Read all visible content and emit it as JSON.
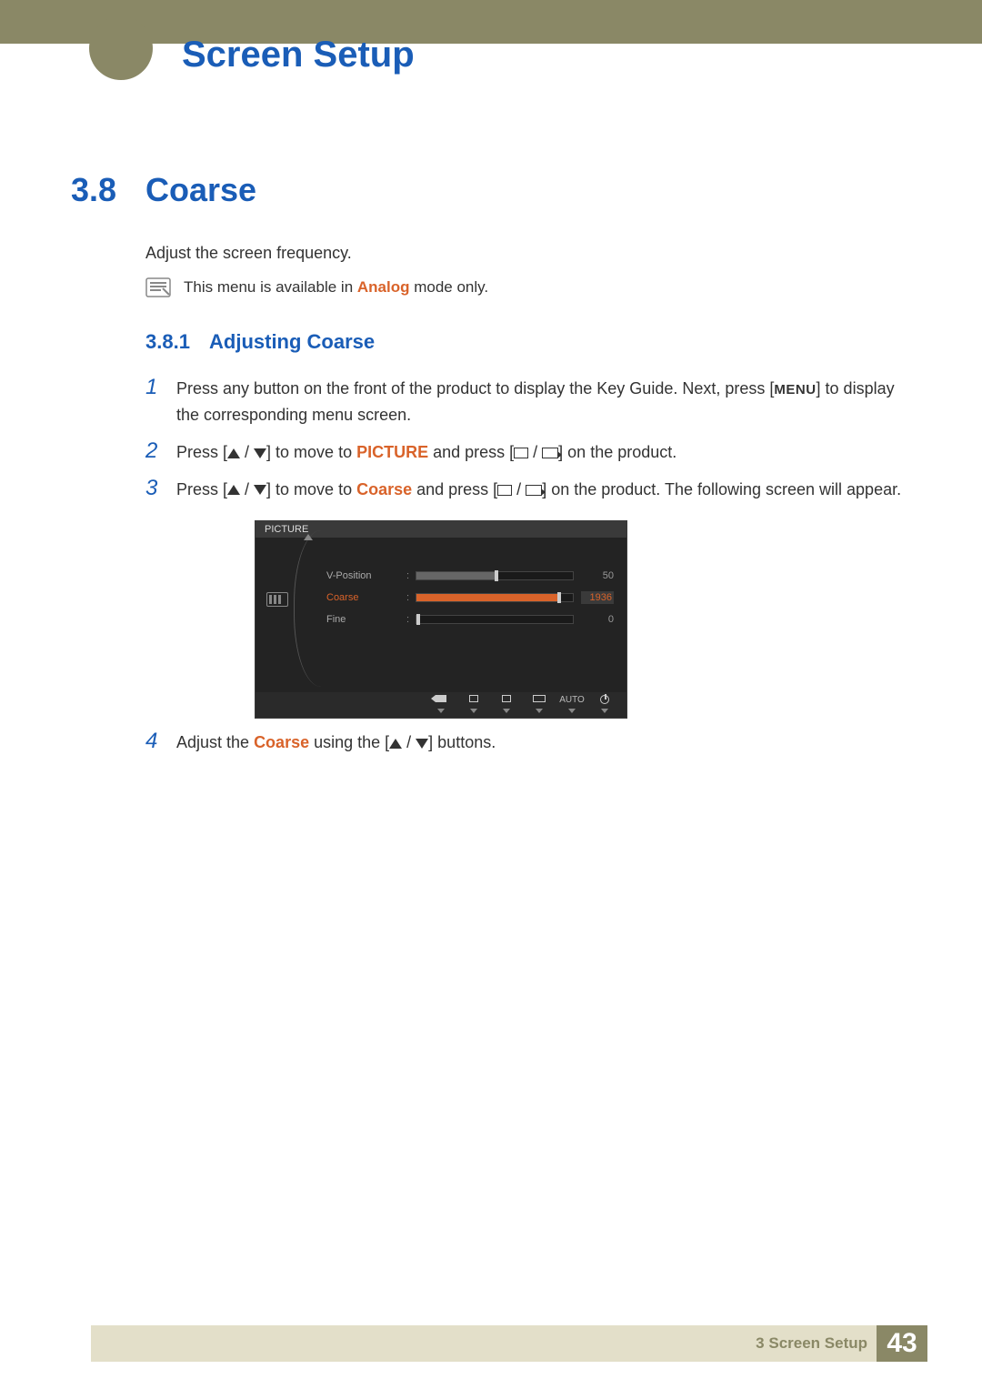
{
  "header": {
    "chapter_title": "Screen Setup"
  },
  "section": {
    "number": "3.8",
    "title": "Coarse",
    "intro": "Adjust the screen frequency.",
    "note_prefix": "This menu is available in ",
    "note_mode": "Analog",
    "note_suffix": " mode only."
  },
  "subsection": {
    "number": "3.8.1",
    "title": "Adjusting Coarse"
  },
  "steps": {
    "s1": {
      "num": "1",
      "a": "Press any button on the front of the product to display the Key Guide. Next, press [",
      "menu": "MENU",
      "b": "] to display the corresponding menu screen."
    },
    "s2": {
      "num": "2",
      "a": "Press [",
      "b": "] to move to ",
      "target": "PICTURE",
      "c": " and press [",
      "d": "] on the product."
    },
    "s3": {
      "num": "3",
      "a": "Press [",
      "b": "] to move to ",
      "target": "Coarse",
      "c": " and press [",
      "d": "] on the product. The following screen will appear."
    },
    "s4": {
      "num": "4",
      "a": "Adjust the ",
      "target": "Coarse",
      "b": " using the [",
      "c": "] buttons."
    }
  },
  "osd": {
    "title": "PICTURE",
    "rows": {
      "r1": {
        "label": "V-Position",
        "value": "50",
        "fill_pct": 50
      },
      "r2": {
        "label": "Coarse",
        "value": "1936",
        "fill_pct": 90
      },
      "r3": {
        "label": "Fine",
        "value": "0",
        "fill_pct": 0
      }
    },
    "buttons": {
      "auto": "AUTO"
    }
  },
  "footer": {
    "label": "3 Screen Setup",
    "page": "43"
  }
}
